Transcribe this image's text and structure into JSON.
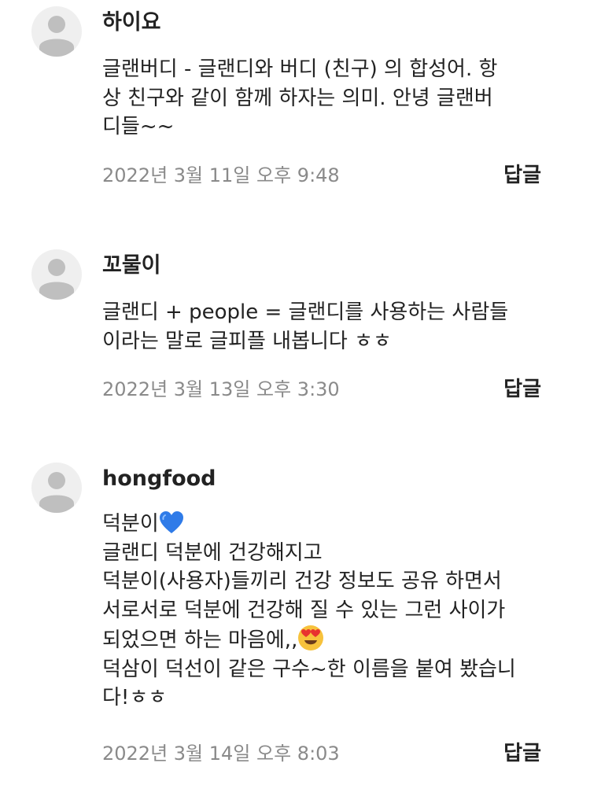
{
  "comments": [
    {
      "author": "하이요",
      "lines": [
        "글랜버디 - 글랜디와 버디 (친구) 의 합성어. 항",
        "상 친구와 같이 함께 하자는 의미.  안녕 글랜버",
        "디들~~"
      ],
      "timestamp": "2022년 3월 11일 오후 9:48",
      "reply_label": "답글"
    },
    {
      "author": "꼬물이",
      "lines": [
        "글랜디 + people = 글랜디를 사용하는 사람들",
        "이라는 말로 글피플 내봅니다 ㅎㅎ"
      ],
      "timestamp": "2022년 3월 13일 오후 3:30",
      "reply_label": "답글"
    },
    {
      "author": "hongfood",
      "lines": [
        "덕분이",
        "글랜디 덕분에 건강해지고",
        "덕분이(사용자)들끼리 건강 정보도 공유 하면서",
        "서로서로 덕분에 건강해 질 수 있는 그런 사이가",
        "되었으면 하는 마음에,,",
        "덕삼이 덕선이 같은 구수~한 이름을 붙여 봤습니",
        "다!ㅎㅎ"
      ],
      "emoji": {
        "blue_heart_after_line": 0,
        "heart_eyes_after_line": 4,
        "heart_color": "#2f7be8",
        "face_color": "#f7c23c",
        "eye_heart_color": "#e8322f"
      },
      "timestamp": "2022년 3월 14일 오후 8:03",
      "reply_label": "답글"
    }
  ],
  "colors": {
    "text": "#222222",
    "meta": "#8a8a8a",
    "avatar_bg": "#efefef",
    "avatar_fg": "#bfbfbf"
  }
}
